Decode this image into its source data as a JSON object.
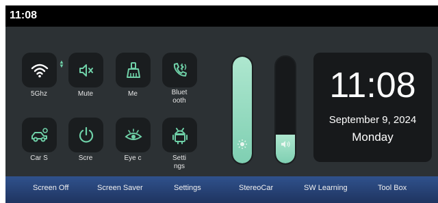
{
  "status_bar": {
    "time": "11:08"
  },
  "quick_tiles": [
    {
      "label": "5Ghz",
      "icon": "wifi-icon"
    },
    {
      "label": "Mute",
      "icon": "mute-icon"
    },
    {
      "label": "Me",
      "icon": "broom-icon"
    },
    {
      "label": "Bluet\nooth",
      "icon": "bluetooth-phone-icon"
    },
    {
      "label": "Car S",
      "icon": "car-settings-icon"
    },
    {
      "label": "Scre",
      "icon": "power-icon"
    },
    {
      "label": "Eye c",
      "icon": "eye-icon"
    },
    {
      "label": "Setti\nngs",
      "icon": "android-icon"
    }
  ],
  "sliders": {
    "brightness": {
      "icon": "brightness-icon",
      "level": 1.0
    },
    "volume": {
      "icon": "volume-icon",
      "level": 0.27
    }
  },
  "clock": {
    "time": "11:08",
    "date": "September 9, 2024",
    "day": "Monday"
  },
  "bottom_nav": [
    "Screen Off",
    "Screen Saver",
    "Settings",
    "StereoCar",
    "SW Learning",
    "Tool Box"
  ],
  "colors": {
    "accent": "#6fd1a8",
    "panel": "#2c3134",
    "tile": "#1a1d1f"
  }
}
